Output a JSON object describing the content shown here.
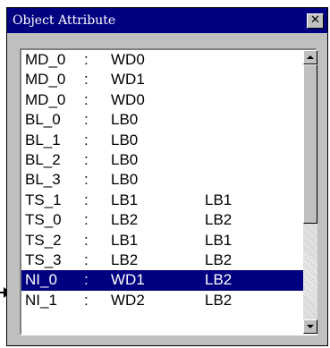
{
  "window": {
    "title": "Object Attribute",
    "close_glyph": "✕"
  },
  "list": {
    "rows": [
      {
        "name": "MD_0",
        "sep": ":",
        "value": "WD0",
        "extra": ""
      },
      {
        "name": "MD_0",
        "sep": ":",
        "value": "WD1",
        "extra": ""
      },
      {
        "name": "MD_0",
        "sep": ":",
        "value": "WD0",
        "extra": ""
      },
      {
        "name": "BL_0",
        "sep": ":",
        "value": "LB0",
        "extra": ""
      },
      {
        "name": "BL_1",
        "sep": ":",
        "value": "LB0",
        "extra": ""
      },
      {
        "name": "BL_2",
        "sep": ":",
        "value": "LB0",
        "extra": ""
      },
      {
        "name": "BL_3",
        "sep": ":",
        "value": "LB0",
        "extra": ""
      },
      {
        "name": "TS_1",
        "sep": ":",
        "value": "LB1",
        "extra": "LB1"
      },
      {
        "name": "TS_0",
        "sep": ":",
        "value": "LB2",
        "extra": "LB2"
      },
      {
        "name": "TS_2",
        "sep": ":",
        "value": "LB1",
        "extra": "LB1"
      },
      {
        "name": "TS_3",
        "sep": ":",
        "value": "LB2",
        "extra": "LB2"
      },
      {
        "name": "NI_0",
        "sep": ":",
        "value": "WD1",
        "extra": "LB2"
      },
      {
        "name": "NI_1",
        "sep": ":",
        "value": "WD2",
        "extra": "LB2"
      }
    ],
    "selected_index": 11
  },
  "colors": {
    "title_bar": "#000080",
    "selection": "#000080",
    "face": "#c0c0c0"
  },
  "icons": {
    "pointer": "arrow-right-icon",
    "scroll_up": "triangle-up-icon",
    "scroll_down": "triangle-down-icon"
  }
}
